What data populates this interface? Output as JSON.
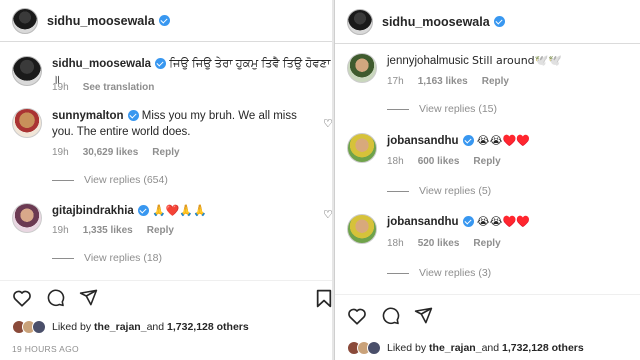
{
  "left": {
    "header_username": "sidhu_moosewala",
    "post": {
      "username": "sidhu_moosewala",
      "caption": "ਜਿਉ ਜਿਉ ਤੇਰਾ ਹੁਕਮੁ ਤਿਵੈ ਤਿਉ ਹੋਵਣਾ ॥",
      "age": "19h",
      "see_translation": "See translation"
    },
    "comments": [
      {
        "username": "sunnymalton",
        "text": "Miss you my bruh. We all miss you. The entire world does.",
        "age": "19h",
        "likes": "30,629 likes",
        "reply": "Reply",
        "view_replies": "View replies (654)"
      },
      {
        "username": "gitajbindrakhia",
        "text": "🙏❤️🙏🙏",
        "age": "19h",
        "likes": "1,335 likes",
        "reply": "Reply",
        "view_replies": "View replies (18)"
      }
    ],
    "liked_by_prefix": "Liked by ",
    "liked_by_user": "the_rajan_",
    "liked_by_and": " and ",
    "liked_by_count": "1,732,128 others",
    "timestamp": "19 HOURS AGO"
  },
  "right": {
    "header_username": "sidhu_moosewala",
    "comments": [
      {
        "username": "jennyjohalmusic",
        "text": "Still around🕊️🕊️",
        "age": "17h",
        "likes": "1,163 likes",
        "reply": "Reply",
        "view_replies": "View replies (15)"
      },
      {
        "username": "jobansandhu",
        "text": "😭😭♥️♥️",
        "age": "18h",
        "likes": "600 likes",
        "reply": "Reply",
        "view_replies": "View replies (5)"
      },
      {
        "username": "jobansandhu",
        "text": "😭😭♥️♥️",
        "age": "18h",
        "likes": "520 likes",
        "reply": "Reply",
        "view_replies": "View replies (3)"
      }
    ],
    "liked_by_prefix": "Liked by ",
    "liked_by_user": "the_rajan_",
    "liked_by_and": " and ",
    "liked_by_count": "1,732,128 others"
  },
  "icons": {
    "like": "heart-icon",
    "comment": "comment-icon",
    "share": "paper-plane-icon",
    "save": "bookmark-icon",
    "verified": "verified-badge-icon"
  },
  "colors": {
    "verified": "#3897f0",
    "muted_text": "#8e8e8e",
    "text": "#262626"
  }
}
